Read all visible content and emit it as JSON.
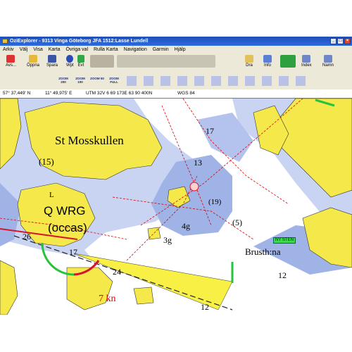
{
  "window": {
    "title": "OziExplorer - 9313 Vinga Göteborg      JFA 1512:Lasse Lundell"
  },
  "menu": [
    "Arkiv",
    "Välj",
    "Visa",
    "Karta",
    "Övriga val",
    "Rulla Karta",
    "Navigation",
    "Garmin",
    "Hjälp"
  ],
  "toolbar": {
    "avs": "Avs...",
    "oppna": "Öppna",
    "spara": "Spara",
    "wpt": "Wpt",
    "evt": "Evt",
    "zoom_value": "100",
    "dra": "Dra",
    "info": "Info",
    "index": "Index",
    "namn": "Namn",
    "zoom_buttons": [
      "ZOOM 200",
      "ZOOM 100",
      "ZOOM 50",
      "ZOOM FULL"
    ]
  },
  "status": {
    "lat": "57° 37,449' N",
    "lon": "11° 49,975' E",
    "utm": "UTM  32V   6 69 173E   63 90 400N",
    "datum": "WGS 84"
  },
  "map_labels": {
    "island1": "St Mosskullen",
    "light": "Q WRG",
    "occas": "(occas)",
    "brusth": "Brusth:na",
    "waypoint": "NY STEN",
    "d15": "(15)",
    "d13": "13",
    "d17": "17",
    "d19": "(19)",
    "d4": "4g",
    "d5": "(5)",
    "d3": "3g",
    "d12a": "12",
    "d12b": "12",
    "d24": "24",
    "d26": "26",
    "d17b": "17",
    "kn": "7 kn",
    "l": "L"
  },
  "colors": {
    "land": "#f5e84a",
    "shallow": "#9fb3e6",
    "mid": "#c7d3f1",
    "deep": "#ffffff",
    "route": "#e00000"
  }
}
